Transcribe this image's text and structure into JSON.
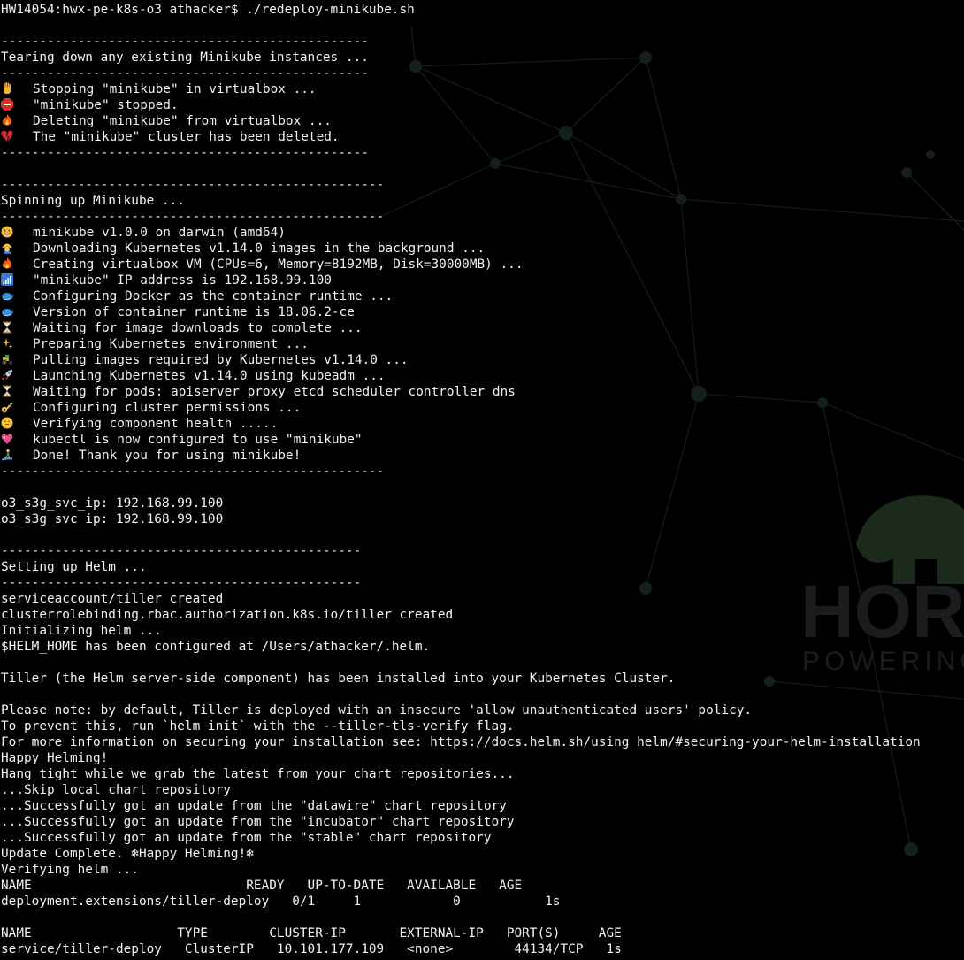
{
  "watermark": {
    "brand_text": "HORT",
    "tagline_text": "POWERING"
  },
  "terminal": {
    "colors": {
      "background": "#000000",
      "foreground": "#f2f2f2",
      "brand_overlay": "#1c2a1c"
    },
    "lines": [
      "HW14054:hwx-pe-k8s-o3 athacker$ ./redeploy-minikube.sh",
      "",
      "------------------------------------------------",
      "Tearing down any existing Minikube instances ...",
      "------------------------------------------------",
      {
        "icon": "raised-hand-icon",
        "text": "Stopping \"minikube\" in virtualbox ..."
      },
      {
        "icon": "stop-sign-icon",
        "text": "\"minikube\" stopped."
      },
      {
        "icon": "fire-icon",
        "text": "Deleting \"minikube\" from virtualbox ..."
      },
      {
        "icon": "broken-heart-icon",
        "text": "The \"minikube\" cluster has been deleted."
      },
      "------------------------------------------------",
      "",
      "--------------------------------------------------",
      "Spinning up Minikube ...",
      "--------------------------------------------------",
      {
        "icon": "grinning-face-icon",
        "text": "minikube v1.0.0 on darwin (amd64)"
      },
      {
        "icon": "construction-worker-icon",
        "text": "Downloading Kubernetes v1.14.0 images in the background ..."
      },
      {
        "icon": "fire-icon",
        "text": "Creating virtualbox VM (CPUs=6, Memory=8192MB, Disk=30000MB) ..."
      },
      {
        "icon": "signal-bars-icon",
        "text": "\"minikube\" IP address is 192.168.99.100"
      },
      {
        "icon": "whale-icon",
        "text": "Configuring Docker as the container runtime ..."
      },
      {
        "icon": "whale-icon",
        "text": "Version of container runtime is 18.06.2-ce"
      },
      {
        "icon": "hourglass-icon",
        "text": "Waiting for image downloads to complete ..."
      },
      {
        "icon": "sparkles-icon",
        "text": "Preparing Kubernetes environment ..."
      },
      {
        "icon": "tractor-icon",
        "text": "Pulling images required by Kubernetes v1.14.0 ..."
      },
      {
        "icon": "rocket-icon",
        "text": "Launching Kubernetes v1.14.0 using kubeadm ..."
      },
      {
        "icon": "hourglass-icon",
        "text": "Waiting for pods: apiserver proxy etcd scheduler controller dns"
      },
      {
        "icon": "key-icon",
        "text": "Configuring cluster permissions ..."
      },
      {
        "icon": "thinking-face-icon",
        "text": "Verifying component health ....."
      },
      {
        "icon": "sparkling-heart-icon",
        "text": "kubectl is now configured to use \"minikube\""
      },
      {
        "icon": "surfer-icon",
        "text": "Done! Thank you for using minikube!"
      },
      "--------------------------------------------------",
      "",
      "o3_s3g_svc_ip: 192.168.99.100",
      "o3_s3g_svc_ip: 192.168.99.100",
      "",
      "-----------------------------------------------",
      "Setting up Helm ...",
      "-----------------------------------------------",
      "serviceaccount/tiller created",
      "clusterrolebinding.rbac.authorization.k8s.io/tiller created",
      "Initializing helm ...",
      "$HELM_HOME has been configured at /Users/athacker/.helm.",
      "",
      "Tiller (the Helm server-side component) has been installed into your Kubernetes Cluster.",
      "",
      "Please note: by default, Tiller is deployed with an insecure 'allow unauthenticated users' policy.",
      "To prevent this, run `helm init` with the --tiller-tls-verify flag.",
      "For more information on securing your installation see: https://docs.helm.sh/using_helm/#securing-your-helm-installation",
      "Happy Helming!",
      "Hang tight while we grab the latest from your chart repositories...",
      "...Skip local chart repository",
      "...Successfully got an update from the \"datawire\" chart repository",
      "...Successfully got an update from the \"incubator\" chart repository",
      "...Successfully got an update from the \"stable\" chart repository",
      "Update Complete. ❄Happy Helming!❄",
      "Verifying helm ...",
      "NAME                            READY   UP-TO-DATE   AVAILABLE   AGE",
      "deployment.extensions/tiller-deploy   0/1     1            0           1s",
      "",
      "NAME                   TYPE        CLUSTER-IP       EXTERNAL-IP   PORT(S)     AGE",
      "service/tiller-deploy   ClusterIP   10.101.177.109   <none>        44134/TCP   1s"
    ]
  }
}
